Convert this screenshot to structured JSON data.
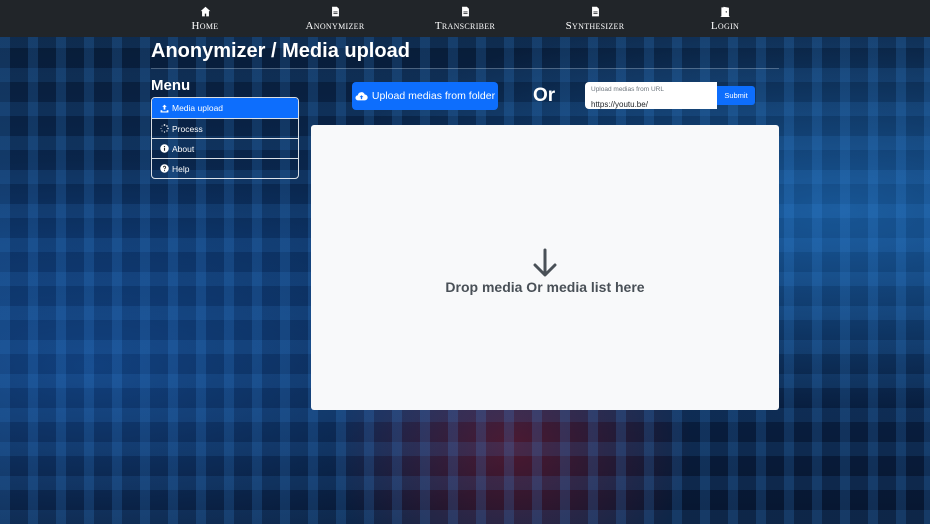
{
  "nav": [
    {
      "label": "Home",
      "icon": "home-icon"
    },
    {
      "label": "Anonymizer",
      "icon": "file-icon"
    },
    {
      "label": "Transcriber",
      "icon": "file-icon"
    },
    {
      "label": "Synthesizer",
      "icon": "file-icon"
    },
    {
      "label": "Login",
      "icon": "door-icon"
    }
  ],
  "page": {
    "title": "Anonymizer / Media upload"
  },
  "menu": {
    "title": "Menu",
    "items": [
      {
        "label": "Media upload",
        "icon": "upload-icon"
      },
      {
        "label": "Process",
        "icon": "spinner-icon"
      },
      {
        "label": "About",
        "icon": "info-icon"
      },
      {
        "label": "Help",
        "icon": "question-icon"
      }
    ]
  },
  "upload": {
    "folder_button": "Upload medias from folder",
    "or": "Or",
    "url_label": "Upload medias from URL",
    "url_value": "https://youtu.be/",
    "submit": "Submit"
  },
  "dropzone": {
    "text": "Drop media Or media list here"
  },
  "colors": {
    "navbar": "#212529",
    "primary": "#0d6efd",
    "dropzone_bg": "#f8f9fa"
  }
}
